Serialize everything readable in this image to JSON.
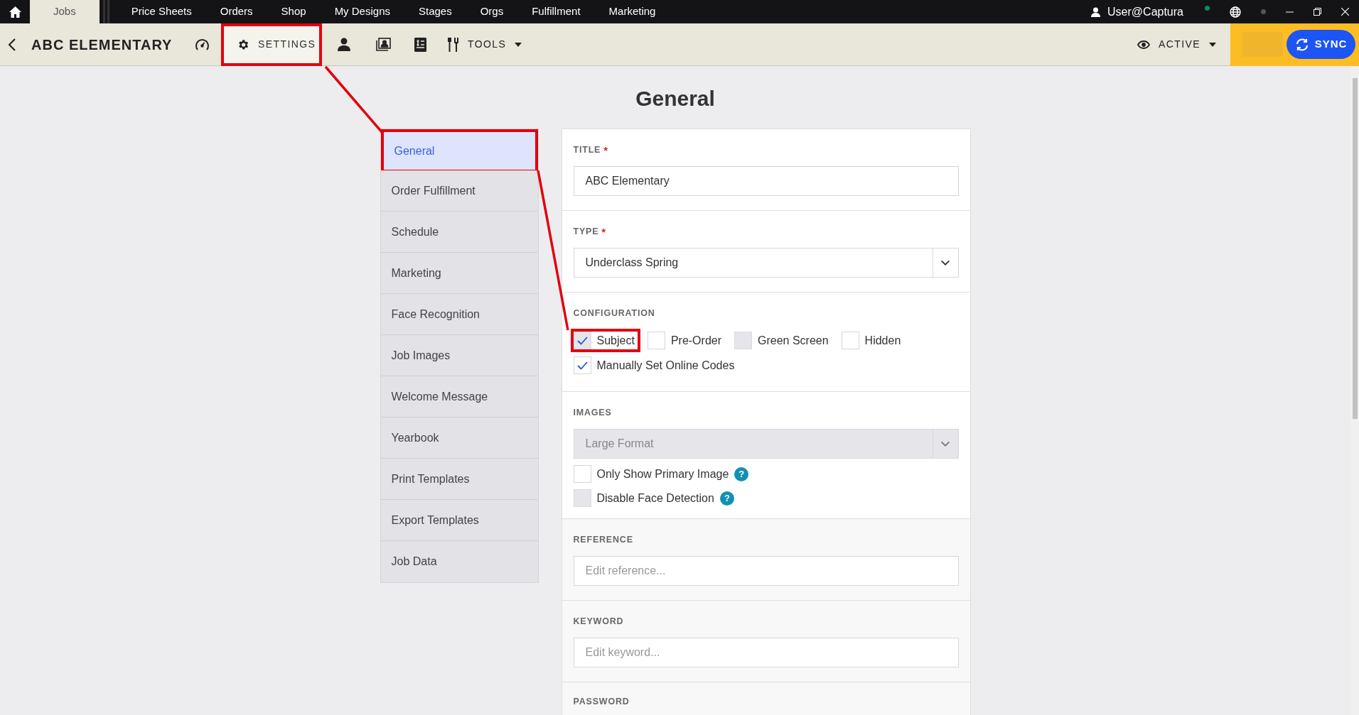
{
  "top_nav": {
    "tabs": [
      {
        "label": "Jobs",
        "selected": true
      },
      {
        "label": "Price Sheets",
        "selected": false
      },
      {
        "label": "Orders",
        "selected": false
      },
      {
        "label": "Shop",
        "selected": false
      },
      {
        "label": "My Designs",
        "selected": false
      },
      {
        "label": "Stages",
        "selected": false
      },
      {
        "label": "Orgs",
        "selected": false
      },
      {
        "label": "Fulfillment",
        "selected": false
      },
      {
        "label": "Marketing",
        "selected": false
      }
    ],
    "user": "User@Captura"
  },
  "toolbar": {
    "title": "ABC ELEMENTARY",
    "settings": {
      "label": "SETTINGS",
      "selected": true,
      "highlighted": true
    },
    "tools": {
      "label": "TOOLS"
    },
    "status": {
      "label": "ACTIVE"
    },
    "sync_button": "SYNC"
  },
  "page_title": "General",
  "sidebar": {
    "items": [
      {
        "label": "General",
        "selected": true,
        "highlighted": true
      },
      {
        "label": "Order Fulfillment",
        "selected": false,
        "highlighted": false
      },
      {
        "label": "Schedule",
        "selected": false,
        "highlighted": false
      },
      {
        "label": "Marketing",
        "selected": false,
        "highlighted": false
      },
      {
        "label": "Face Recognition",
        "selected": false,
        "highlighted": false
      },
      {
        "label": "Job Images",
        "selected": false,
        "highlighted": false
      },
      {
        "label": "Welcome Message",
        "selected": false,
        "highlighted": false
      },
      {
        "label": "Yearbook",
        "selected": false,
        "highlighted": false
      },
      {
        "label": "Print Templates",
        "selected": false,
        "highlighted": false
      },
      {
        "label": "Export Templates",
        "selected": false,
        "highlighted": false
      },
      {
        "label": "Job Data",
        "selected": false,
        "highlighted": false
      }
    ]
  },
  "form": {
    "title_field": {
      "label": "TITLE",
      "required": "*",
      "value": "ABC Elementary"
    },
    "type_field": {
      "label": "TYPE",
      "required": "*",
      "value": "Underclass Spring"
    },
    "configuration": {
      "label": "CONFIGURATION",
      "options": [
        {
          "label": "Subject",
          "checked": true,
          "disabled": true,
          "highlighted": true
        },
        {
          "label": "Pre-Order",
          "checked": false,
          "disabled": false,
          "highlighted": false
        },
        {
          "label": "Green Screen",
          "checked": false,
          "disabled": true,
          "highlighted": false
        },
        {
          "label": "Hidden",
          "checked": false,
          "disabled": false,
          "highlighted": false
        },
        {
          "label": "Manually Set Online Codes",
          "checked": true,
          "disabled": false,
          "highlighted": false
        }
      ]
    },
    "images": {
      "label": "IMAGES",
      "select": {
        "value": "Large Format",
        "disabled": true
      },
      "options": [
        {
          "label": "Only Show Primary Image",
          "checked": false,
          "disabled": false,
          "help": "?"
        },
        {
          "label": "Disable Face Detection",
          "checked": false,
          "disabled": true,
          "help": "?"
        }
      ]
    },
    "reference": {
      "label": "REFERENCE",
      "placeholder": "Edit reference..."
    },
    "keyword": {
      "label": "KEYWORD",
      "placeholder": "Edit keyword..."
    },
    "password": {
      "label": "PASSWORD"
    }
  }
}
